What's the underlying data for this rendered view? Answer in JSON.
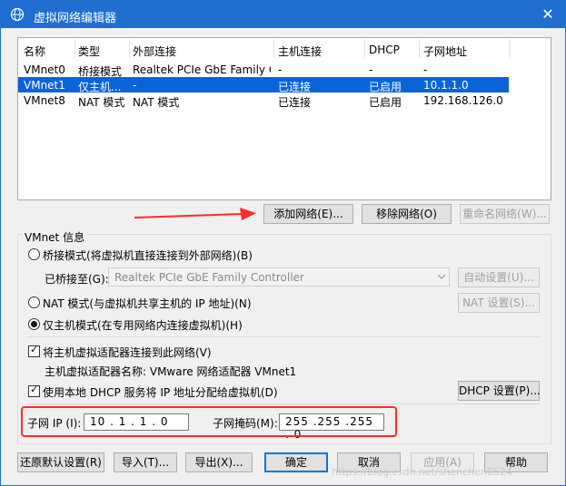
{
  "window": {
    "title": "虚拟网络编辑器",
    "close": "✕"
  },
  "table": {
    "headers": [
      "名称",
      "类型",
      "外部连接",
      "主机连接",
      "DHCP",
      "子网地址"
    ],
    "rows": [
      {
        "name": "VMnet0",
        "type": "桥接模式",
        "external": "Realtek PCIe GbE Family Co...",
        "host": "-",
        "dhcp": "-",
        "subnet": "-"
      },
      {
        "name": "VMnet1",
        "type": "仅主机...",
        "external": "-",
        "host": "已连接",
        "dhcp": "已启用",
        "subnet": "10.1.1.0",
        "selected": true
      },
      {
        "name": "VMnet8",
        "type": "NAT 模式",
        "external": "NAT 模式",
        "host": "已连接",
        "dhcp": "已启用",
        "subnet": "192.168.126.0"
      }
    ]
  },
  "list_buttons": {
    "add": "添加网络(E)...",
    "remove": "移除网络(O)",
    "rename": "重命名网络(W)..."
  },
  "vmnet_info": {
    "label": "VMnet 信息",
    "bridged": "桥接模式(将虚拟机直接连接到外部网络)(B)",
    "bridged_to_label": "已桥接至(G):",
    "bridged_to_value": "Realtek PCIe GbE Family Controller",
    "auto_settings": "自动设置(U)...",
    "nat": "NAT 模式(与虚拟机共享主机的 IP 地址)(N)",
    "nat_settings": "NAT 设置(S)...",
    "host_only": "仅主机模式(在专用网络内连接虚拟机)(H)",
    "connect_adapter": "将主机虚拟适配器连接到此网络(V)",
    "adapter_name": "主机虚拟适配器名称: VMware 网络适配器 VMnet1",
    "use_dhcp": "使用本地 DHCP 服务将 IP 地址分配给虚拟机(D)",
    "dhcp_settings": "DHCP 设置(P)...",
    "subnet_ip_label": "子网 IP (I):",
    "subnet_ip_value": "10 . 1 . 1 . 0",
    "subnet_mask_label": "子网掩码(M):",
    "subnet_mask_value": "255 .255 .255 . 0"
  },
  "footer": {
    "restore": "还原默认设置(R)",
    "import": "导入(T)...",
    "export": "导出(X)...",
    "ok": "确定",
    "cancel": "取消",
    "apply": "应用(A)",
    "help": "帮助"
  },
  "watermark": "https://blog.csdn.net/shenchen0524",
  "colors": {
    "titlebar": "#1e6fd0",
    "selection": "#0a64d8",
    "annotation": "#ff2a2a"
  }
}
